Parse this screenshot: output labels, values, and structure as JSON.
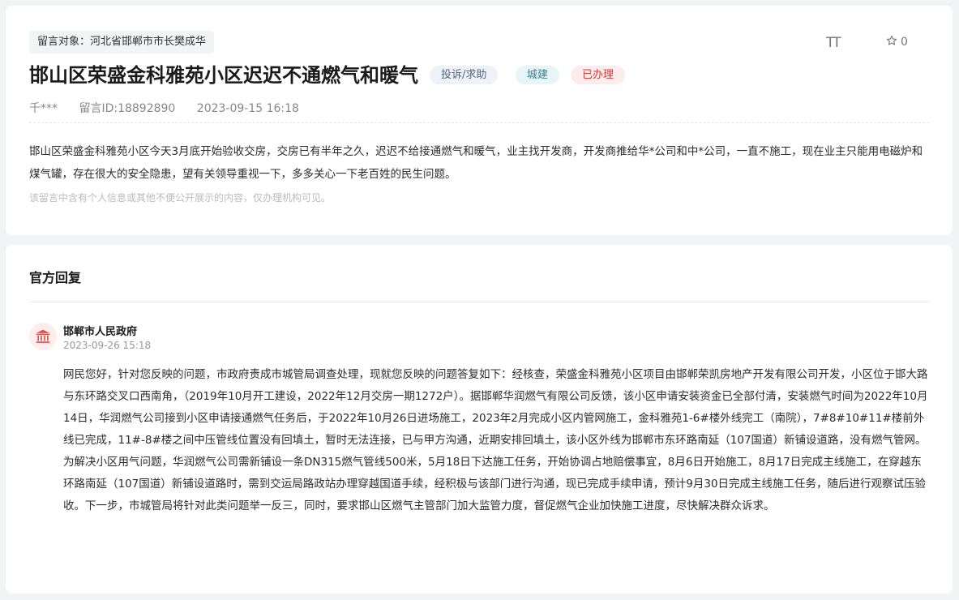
{
  "message": {
    "target": "留言对象：河北省邯郸市市长樊成华",
    "title": "邯山区荣盛金科雅苑小区迟迟不通燃气和暖气",
    "tags": {
      "type": "投诉/求助",
      "category": "城建",
      "status": "已办理"
    },
    "font_size_icon_text": "TT",
    "favorite_count": "0",
    "author": "千***",
    "message_id": "留言ID:18892890",
    "datetime": "2023-09-15 16:18",
    "content": "邯山区荣盛金科雅苑小区今天3月底开始验收交房，交房已有半年之久，迟迟不给接通燃气和暖气，业主找开发商，开发商推给华*公司和中*公司，一直不施工，现在业主只能用电磁炉和煤气罐，存在很大的安全隐患，望有关领导重视一下，多多关心一下老百姓的民生问题。",
    "privacy_notice": "该留言中含有个人信息或其他不便公开展示的内容，仅办理机构可见。"
  },
  "reply": {
    "heading": "官方回复",
    "org_name": "邯郸市人民政府",
    "datetime": "2023-09-26 15:18",
    "content": "网民您好，针对您反映的问题，市政府责成市城管局调查处理，现就您反映的问题答复如下：经核查，荣盛金科雅苑小区项目由邯郸荣凯房地产开发有限公司开发，小区位于邯大路与东环路交叉口西南角，（2019年10月开工建设，2022年12月交房一期1272户）。据邯郸华润燃气有限公司反馈，该小区申请安装资金已全部付清，安装燃气时间为2022年10月14日，华润燃气公司接到小区申请接通燃气任务后，于2022年10月26日进场施工，2023年2月完成小区内管网施工，金科雅苑1-6#楼外线完工（南院），7#8#10#11#楼前外线已完成，11#-8#楼之间中压管线位置没有回填土，暂时无法连接，已与甲方沟通，近期安排回填土，该小区外线为邯郸市东环路南延（107国道）新铺设道路，没有燃气管网。为解决小区用气问题，华润燃气公司需新铺设一条DN315燃气管线500米，5月18日下达施工任务，开始协调占地赔偿事宜，8月6日开始施工，8月17日完成主线施工，在穿越东环路南延（107国道）新铺设道路时，需到交运局路政站办理穿越国道手续，经积极与该部门进行沟通，现已完成手续申请，预计9月30日完成主线施工任务，随后进行观察试压验收。下一步，市城管局将针对此类问题举一反三，同时，要求邯山区燃气主管部门加大监管力度，督促燃气企业加快施工进度，尽快解决群众诉求。"
  },
  "icons": {
    "font_size": "font-size-icon",
    "favorite": "star-icon",
    "org": "government-building-icon"
  },
  "colors": {
    "status_red": "#d23c3c",
    "category_teal": "#3a7f8c",
    "type_gray": "#55657e",
    "org_icon_red": "#d9534f"
  }
}
